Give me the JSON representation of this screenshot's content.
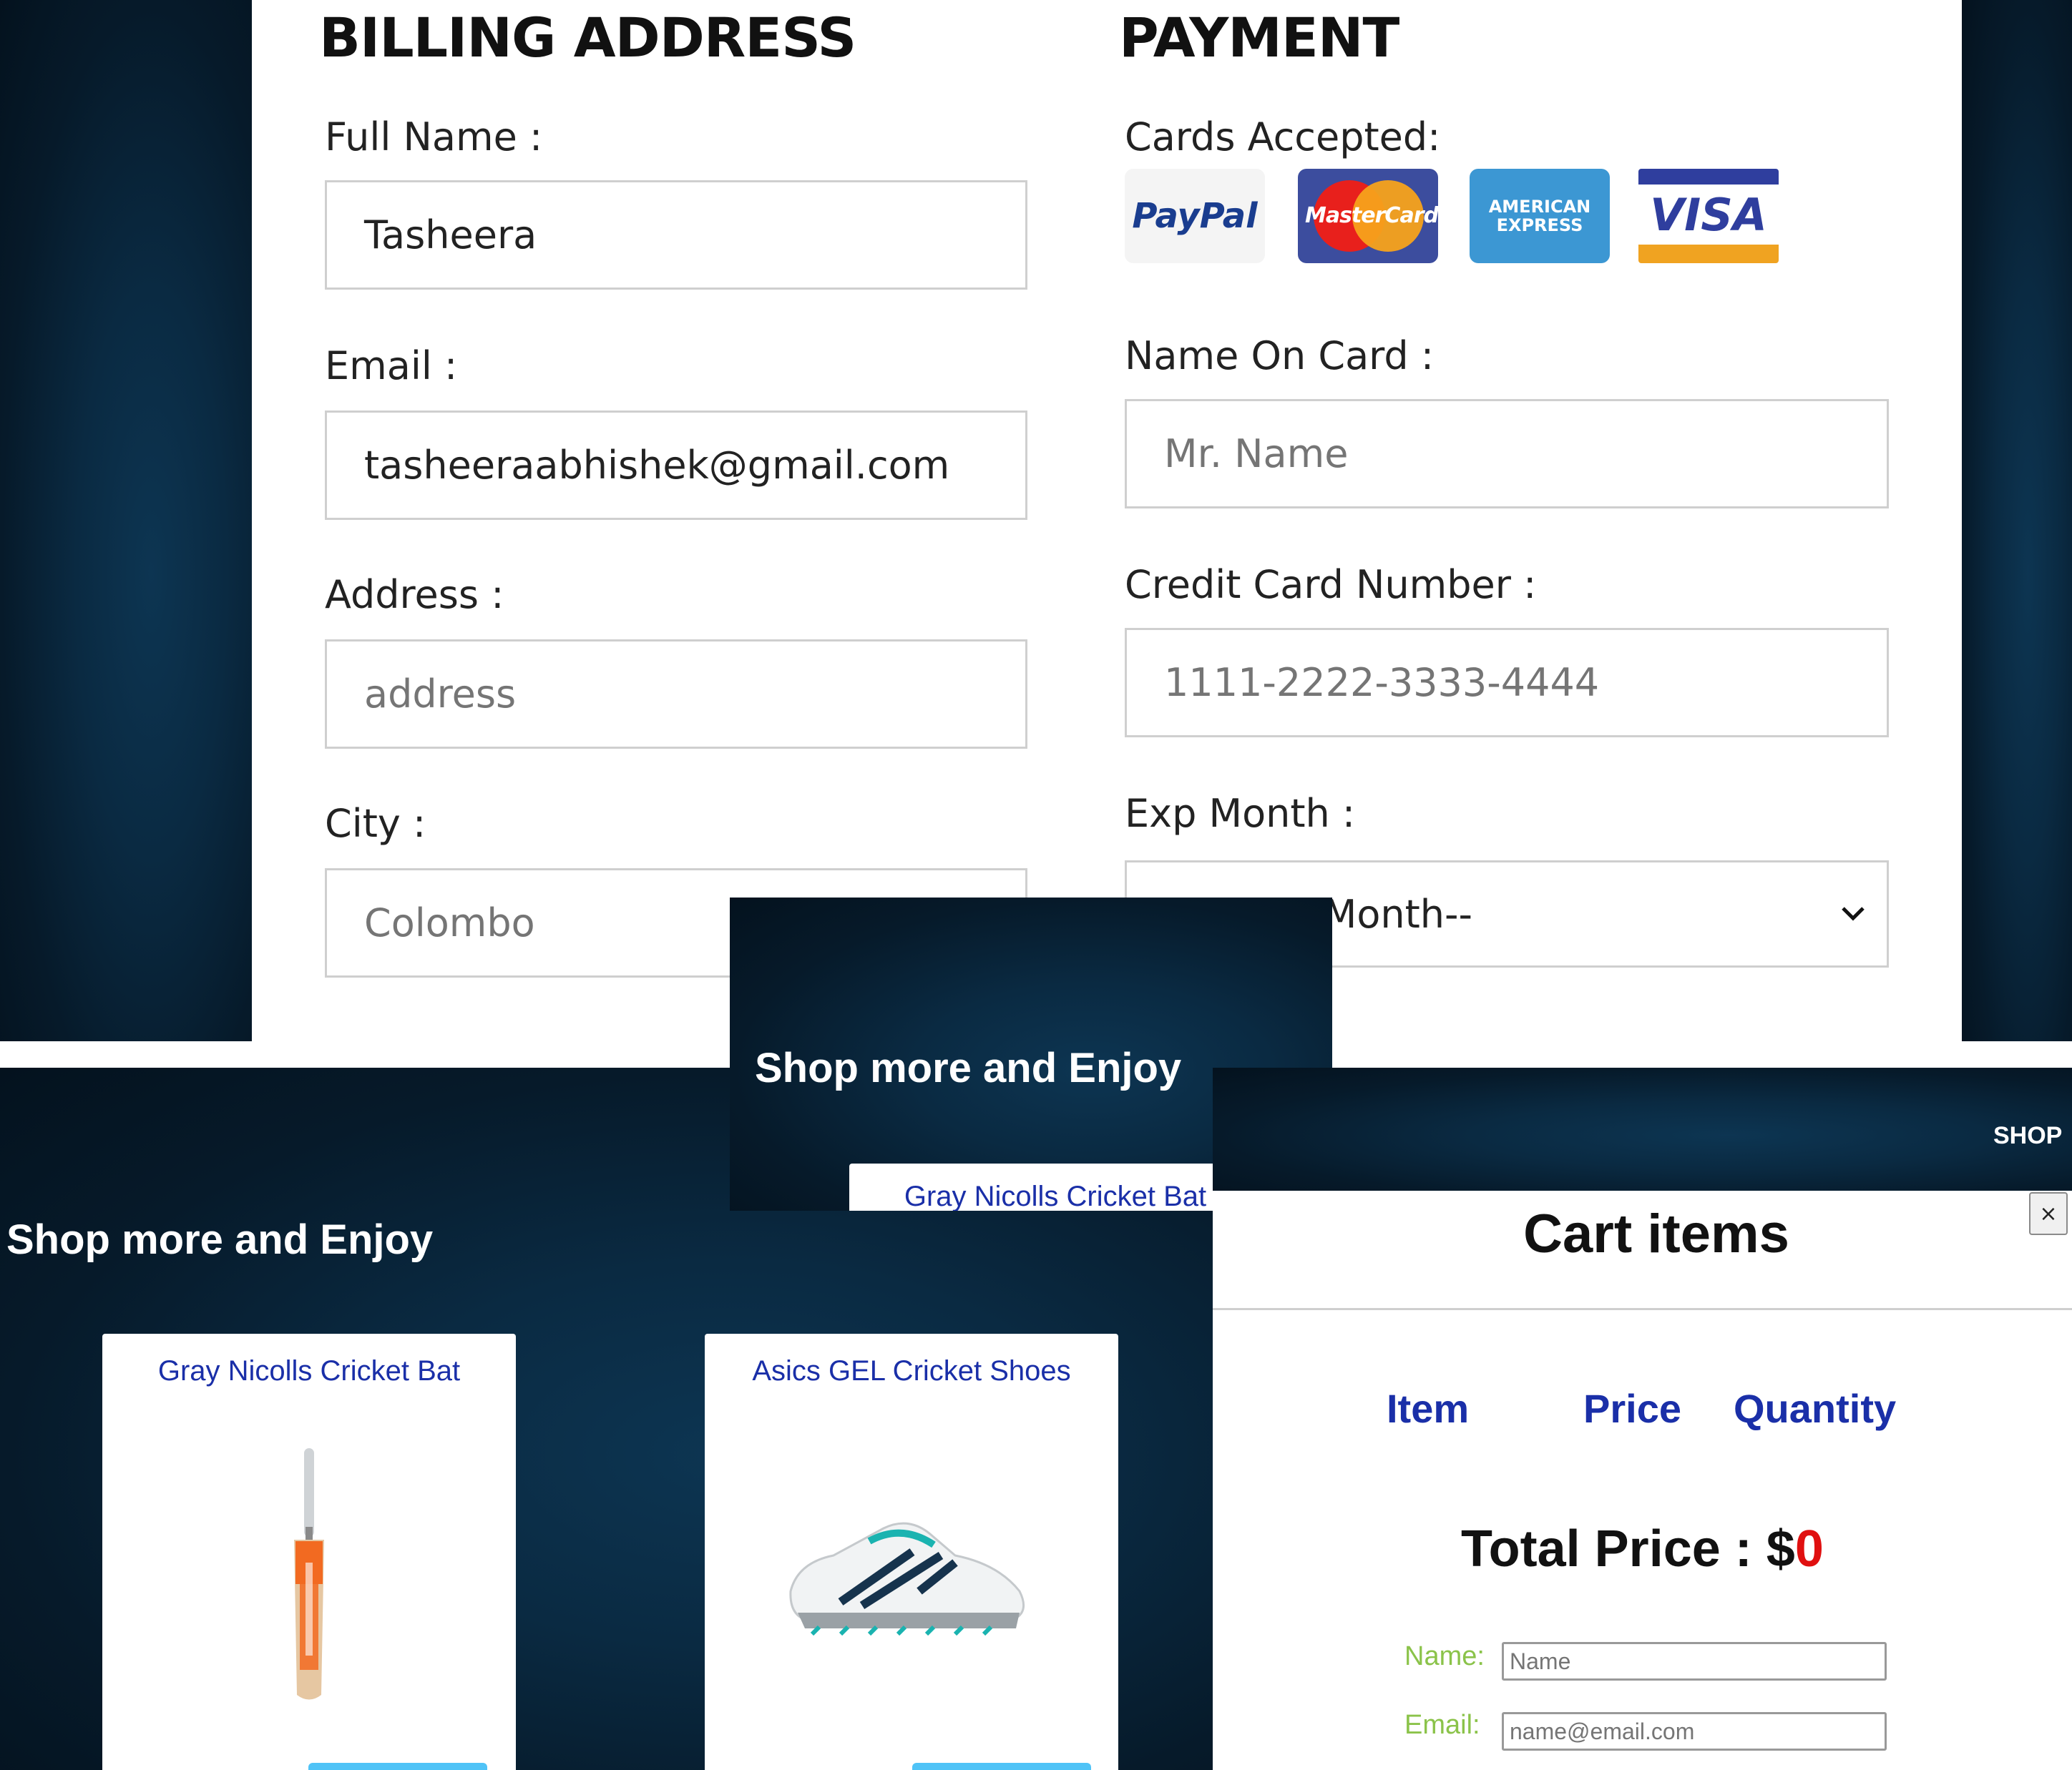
{
  "billing": {
    "title": "BILLING ADDRESS",
    "full_name": {
      "label": "Full Name :",
      "value": "Tasheera"
    },
    "email": {
      "label": "Email :",
      "value": "tasheeraabhishek@gmail.com"
    },
    "address": {
      "label": "Address :",
      "placeholder": "address"
    },
    "city": {
      "label": "City :",
      "value": "Colombo"
    }
  },
  "payment": {
    "title": "PAYMENT",
    "cards_label": "Cards Accepted:",
    "cards": [
      {
        "name": "PayPal",
        "icon": "paypal-logo"
      },
      {
        "name": "MasterCard",
        "icon": "mastercard-logo"
      },
      {
        "name": "AMERICAN EXPRESS",
        "icon": "amex-logo"
      },
      {
        "name": "VISA",
        "icon": "visa-logo"
      }
    ],
    "name_on_card": {
      "label": "Name On Card :",
      "placeholder": "Mr. Name"
    },
    "card_number": {
      "label": "Credit Card Number :",
      "placeholder": "1111-2222-3333-4444"
    },
    "exp_month": {
      "label": "Exp Month :",
      "selected": "--Select Month--"
    }
  },
  "overlay": {
    "title": "Shop more and Enjoy",
    "card_title": "Gray Nicolls Cricket Bat"
  },
  "shop": {
    "title": "Shop more and Enjoy",
    "products": [
      {
        "name": "Gray Nicolls Cricket Bat",
        "icon": "cricket-bat-image"
      },
      {
        "name": "Asics GEL Cricket Shoes",
        "icon": "cricket-shoe-image"
      }
    ]
  },
  "nav": {
    "shop_label": "SHOP"
  },
  "cart": {
    "title": "Cart items",
    "close_label": "×",
    "columns": [
      "Item",
      "Price",
      "Quantity"
    ],
    "total_label": "Total Price : $",
    "total_value": "0",
    "name_field": {
      "label": "Name:",
      "placeholder": "Name"
    },
    "email_field": {
      "label": "Email:",
      "placeholder": "name@email.com"
    }
  },
  "colors": {
    "dark_background": "#061a2a",
    "link_blue": "#1a2fa8",
    "total_red": "#e01010",
    "label_green": "#8bc34a",
    "button_blue": "#4fc3f7"
  }
}
